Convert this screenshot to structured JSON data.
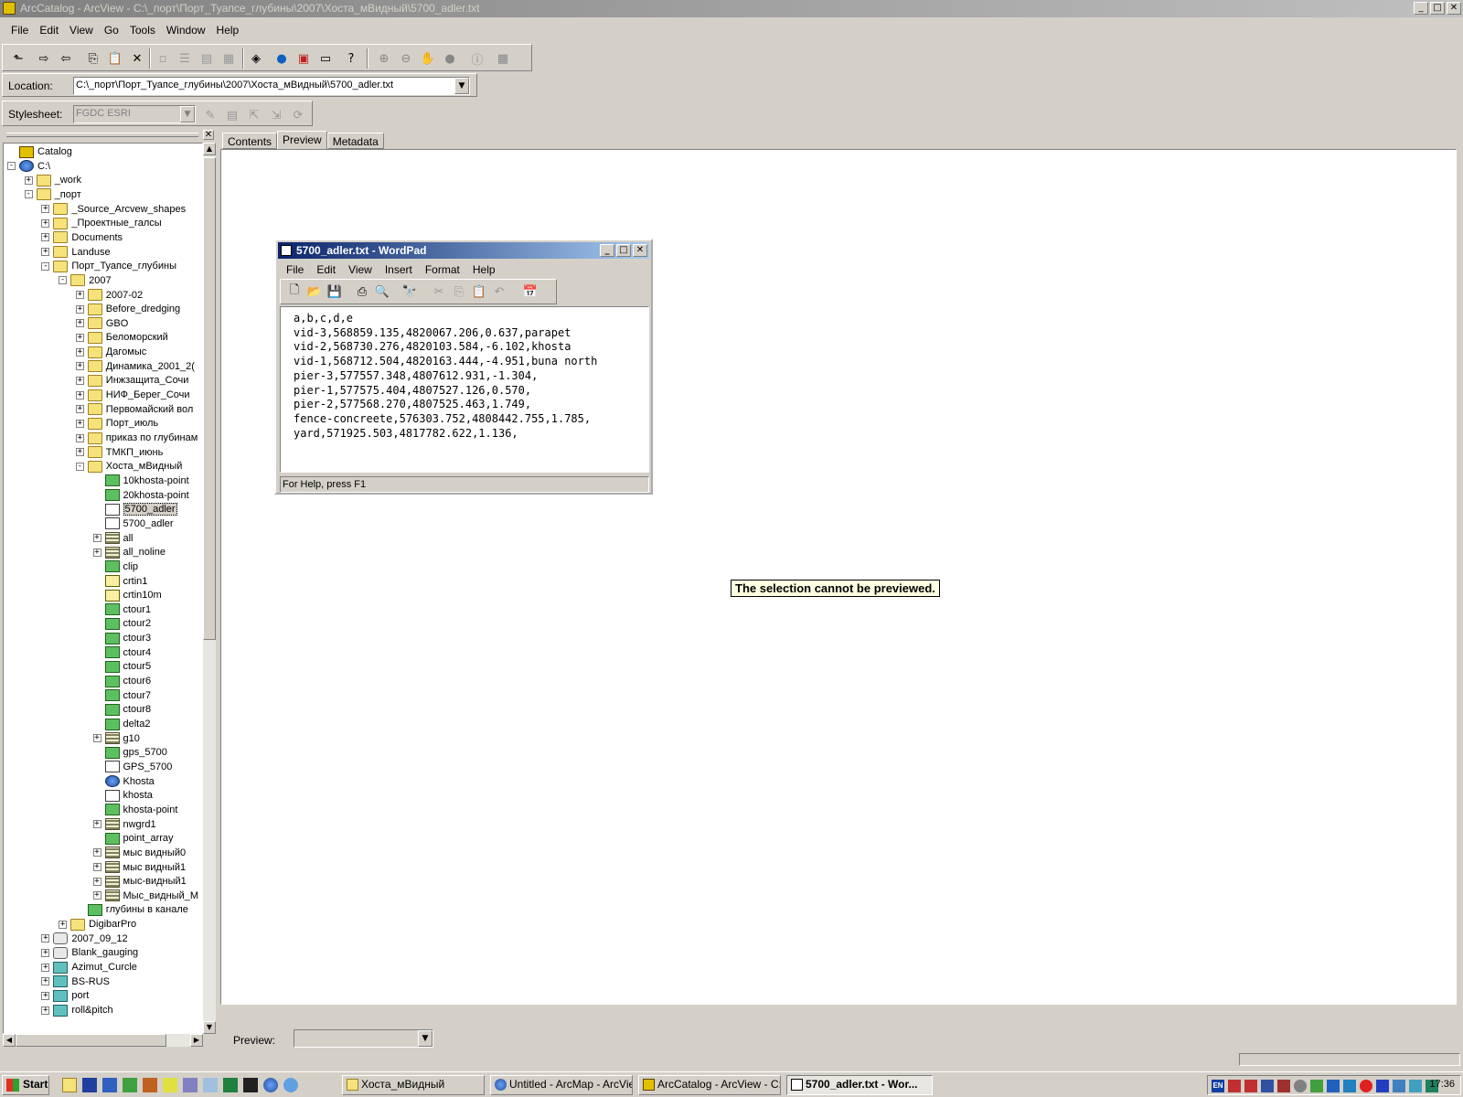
{
  "app": {
    "title": "ArcCatalog - ArcView - C:\\_порт\\Порт_Туапсе_глубины\\2007\\Хоста_мВидный\\5700_adler.txt",
    "win_minimize": "_",
    "win_maximize": "□",
    "win_close": "✕"
  },
  "menubar": [
    "File",
    "Edit",
    "View",
    "Go",
    "Tools",
    "Window",
    "Help"
  ],
  "location": {
    "label": "Location:",
    "value": "C:\\_порт\\Порт_Туапсе_глубины\\2007\\Хоста_мВидный\\5700_adler.txt"
  },
  "stylesheet": {
    "label": "Stylesheet:",
    "value": "FGDC ESRI"
  },
  "tree": {
    "close": "✕",
    "nodes": [
      {
        "label": "Catalog",
        "level": 0,
        "icon": "catalog-icon",
        "exp": ""
      },
      {
        "label": "C:\\",
        "level": 0,
        "icon": "drive-icon",
        "exp": "-"
      },
      {
        "label": "_work",
        "level": 1,
        "icon": "folder-icon",
        "exp": "+"
      },
      {
        "label": "_порт",
        "level": 1,
        "icon": "folder-icon",
        "exp": "-"
      },
      {
        "label": "_Source_Arcvew_shapes",
        "level": 2,
        "icon": "folder-icon",
        "exp": "+"
      },
      {
        "label": "_Проектные_галсы",
        "level": 2,
        "icon": "folder-icon",
        "exp": "+"
      },
      {
        "label": "Documents",
        "level": 2,
        "icon": "folder-icon",
        "exp": "+"
      },
      {
        "label": "Landuse",
        "level": 2,
        "icon": "folder-icon",
        "exp": "+"
      },
      {
        "label": "Порт_Туапсе_глубины",
        "level": 2,
        "icon": "folder-icon",
        "exp": "-"
      },
      {
        "label": "2007",
        "level": 3,
        "icon": "folder-icon",
        "exp": "-"
      },
      {
        "label": "2007-02",
        "level": 4,
        "icon": "folder-icon",
        "exp": "+"
      },
      {
        "label": "Before_dredging",
        "level": 4,
        "icon": "folder-icon",
        "exp": "+"
      },
      {
        "label": "GBO",
        "level": 4,
        "icon": "folder-icon",
        "exp": "+"
      },
      {
        "label": "Беломорский",
        "level": 4,
        "icon": "folder-icon",
        "exp": "+"
      },
      {
        "label": "Дагомыс",
        "level": 4,
        "icon": "folder-icon",
        "exp": "+"
      },
      {
        "label": "Динамика_2001_2(",
        "level": 4,
        "icon": "folder-icon",
        "exp": "+"
      },
      {
        "label": "Инжзащита_Сочи",
        "level": 4,
        "icon": "folder-icon",
        "exp": "+"
      },
      {
        "label": "НИФ_Берег_Сочи",
        "level": 4,
        "icon": "folder-icon",
        "exp": "+"
      },
      {
        "label": "Первомайский вол",
        "level": 4,
        "icon": "folder-icon",
        "exp": "+"
      },
      {
        "label": "Порт_июль",
        "level": 4,
        "icon": "folder-icon",
        "exp": "+"
      },
      {
        "label": "приказ по глубинам",
        "level": 4,
        "icon": "folder-icon",
        "exp": "+"
      },
      {
        "label": "ТМКП_июнь",
        "level": 4,
        "icon": "folder-icon",
        "exp": "+"
      },
      {
        "label": "Хоста_мВидный",
        "level": 4,
        "icon": "folder-icon",
        "exp": "-"
      },
      {
        "label": "10khosta-point",
        "level": 5,
        "icon": "point-layer-icon",
        "exp": ""
      },
      {
        "label": "20khosta-point",
        "level": 5,
        "icon": "point-layer-icon",
        "exp": ""
      },
      {
        "label": "5700_adler",
        "level": 5,
        "icon": "text-file-icon",
        "exp": "",
        "selected": true
      },
      {
        "label": "5700_adler",
        "level": 5,
        "icon": "text-file-icon",
        "exp": ""
      },
      {
        "label": "all",
        "level": 5,
        "icon": "grid-icon",
        "exp": "+"
      },
      {
        "label": "all_noline",
        "level": 5,
        "icon": "grid-icon",
        "exp": "+"
      },
      {
        "label": "clip",
        "level": 5,
        "icon": "line-layer-icon",
        "exp": ""
      },
      {
        "label": "crtin1",
        "level": 5,
        "icon": "tin-icon",
        "exp": ""
      },
      {
        "label": "crtin10m",
        "level": 5,
        "icon": "tin-icon",
        "exp": ""
      },
      {
        "label": "ctour1",
        "level": 5,
        "icon": "line-layer-icon",
        "exp": ""
      },
      {
        "label": "ctour2",
        "level": 5,
        "icon": "line-layer-icon",
        "exp": ""
      },
      {
        "label": "ctour3",
        "level": 5,
        "icon": "line-layer-icon",
        "exp": ""
      },
      {
        "label": "ctour4",
        "level": 5,
        "icon": "line-layer-icon",
        "exp": ""
      },
      {
        "label": "ctour5",
        "level": 5,
        "icon": "line-layer-icon",
        "exp": ""
      },
      {
        "label": "ctour6",
        "level": 5,
        "icon": "line-layer-icon",
        "exp": ""
      },
      {
        "label": "ctour7",
        "level": 5,
        "icon": "line-layer-icon",
        "exp": ""
      },
      {
        "label": "ctour8",
        "level": 5,
        "icon": "line-layer-icon",
        "exp": ""
      },
      {
        "label": "delta2",
        "level": 5,
        "icon": "line-layer-icon",
        "exp": ""
      },
      {
        "label": "g10",
        "level": 5,
        "icon": "grid-icon",
        "exp": "+"
      },
      {
        "label": "gps_5700",
        "level": 5,
        "icon": "point-layer-icon",
        "exp": ""
      },
      {
        "label": "GPS_5700",
        "level": 5,
        "icon": "text-file-icon",
        "exp": ""
      },
      {
        "label": "Khosta",
        "level": 5,
        "icon": "map-document-icon",
        "exp": ""
      },
      {
        "label": "khosta",
        "level": 5,
        "icon": "text-file-icon",
        "exp": ""
      },
      {
        "label": "khosta-point",
        "level": 5,
        "icon": "point-layer-icon",
        "exp": ""
      },
      {
        "label": "nwgrd1",
        "level": 5,
        "icon": "grid-icon",
        "exp": "+"
      },
      {
        "label": "point_array",
        "level": 5,
        "icon": "point-layer-icon",
        "exp": ""
      },
      {
        "label": "мыс видный0",
        "level": 5,
        "icon": "grid-icon",
        "exp": "+"
      },
      {
        "label": "мыс видный1",
        "level": 5,
        "icon": "grid-icon",
        "exp": "+"
      },
      {
        "label": "мыс-видный1",
        "level": 5,
        "icon": "grid-icon",
        "exp": "+"
      },
      {
        "label": "Мыс_видный_M",
        "level": 5,
        "icon": "grid-icon",
        "exp": "+"
      },
      {
        "label": "глубины в канале",
        "level": 4,
        "icon": "point-layer-icon",
        "exp": ""
      },
      {
        "label": "DigibarPro",
        "level": 3,
        "icon": "folder-icon",
        "exp": "+"
      },
      {
        "label": "2007_09_12",
        "level": 2,
        "icon": "database-icon",
        "exp": "+"
      },
      {
        "label": "Blank_gauging",
        "level": 2,
        "icon": "database-icon",
        "exp": "+"
      },
      {
        "label": "Azimut_Curcle",
        "level": 2,
        "icon": "network-icon",
        "exp": "+"
      },
      {
        "label": "BS-RUS",
        "level": 2,
        "icon": "network-icon",
        "exp": "+"
      },
      {
        "label": "port",
        "level": 2,
        "icon": "network-icon",
        "exp": "+"
      },
      {
        "label": "roll&pitch",
        "level": 2,
        "icon": "network-icon",
        "exp": "+"
      }
    ]
  },
  "tabs": [
    {
      "label": "Contents",
      "active": false
    },
    {
      "label": "Preview",
      "active": true
    },
    {
      "label": "Metadata",
      "active": false
    }
  ],
  "preview": {
    "message": "The selection cannot be previewed.",
    "bottom_label": "Preview:",
    "bottom_value": ""
  },
  "wordpad": {
    "title": "5700_adler.txt - WordPad",
    "menu": [
      "File",
      "Edit",
      "View",
      "Insert",
      "Format",
      "Help"
    ],
    "lines": [
      "a,b,c,d,e",
      "vid-3,568859.135,4820067.206,0.637,parapet",
      "vid-2,568730.276,4820103.584,-6.102,khosta",
      "vid-1,568712.504,4820163.444,-4.951,buna north",
      "pier-3,577557.348,4807612.931,-1.304,",
      "pier-1,577575.404,4807527.126,0.570,",
      "pier-2,577568.270,4807525.463,1.749,",
      "fence-concreete,576303.752,4808442.755,1.785,",
      "yard,571925.503,4817782.622,1.136,"
    ],
    "status": "For Help, press F1"
  },
  "taskbar": {
    "start": "Start",
    "tasks": [
      {
        "label": "Хоста_мВидный",
        "active": false
      },
      {
        "label": "Untitled - ArcMap - ArcView",
        "active": false
      },
      {
        "label": "ArcCatalog - ArcView - C:...",
        "active": false
      },
      {
        "label": "5700_adler.txt - Wor...",
        "active": true
      }
    ],
    "lang": "EN",
    "clock": "17:36"
  }
}
